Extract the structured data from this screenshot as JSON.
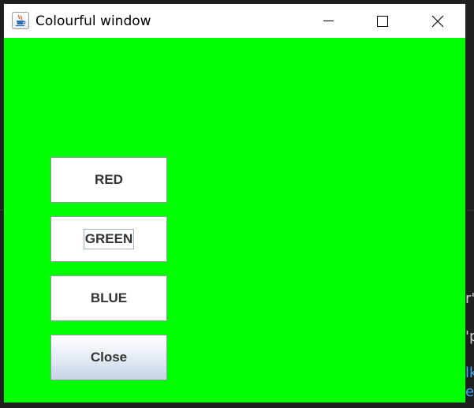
{
  "window": {
    "title": "Colourful window",
    "background_color": "#00ff00",
    "focused_button": "GREEN"
  },
  "buttons": {
    "red_label": "RED",
    "green_label": "GREEN",
    "blue_label": "BLUE",
    "close_label": "Close"
  },
  "background_fragments": {
    "line1": "r'",
    "line2": "'p",
    "line3": "lk",
    "line4": "ec"
  },
  "icons": {
    "app": "java-cup-icon",
    "minimize": "minimize-icon",
    "maximize": "maximize-icon",
    "close": "close-icon"
  }
}
